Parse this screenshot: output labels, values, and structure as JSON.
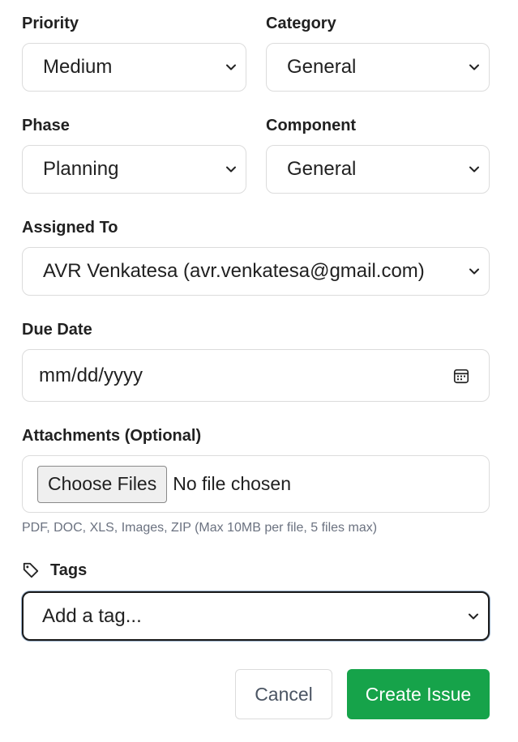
{
  "fields": {
    "priority": {
      "label": "Priority",
      "value": "Medium"
    },
    "category": {
      "label": "Category",
      "value": "General"
    },
    "phase": {
      "label": "Phase",
      "value": "Planning"
    },
    "component": {
      "label": "Component",
      "value": "General"
    },
    "assigned_to": {
      "label": "Assigned To",
      "value": "AVR Venkatesa (avr.venkatesa@gmail.com)"
    },
    "due_date": {
      "label": "Due Date",
      "placeholder": "mm/dd/yyyy"
    },
    "attachments": {
      "label": "Attachments (Optional)",
      "button_label": "Choose Files",
      "status": "No file chosen",
      "hint": "PDF, DOC, XLS, Images, ZIP (Max 10MB per file, 5 files max)"
    },
    "tags": {
      "label": "Tags",
      "placeholder": "Add a tag..."
    }
  },
  "actions": {
    "cancel_label": "Cancel",
    "create_label": "Create Issue"
  },
  "colors": {
    "primary": "#16a34a",
    "border": "#dcdcdc",
    "hint": "#6b7280"
  },
  "icons": {
    "select": "chevron-down-icon",
    "date": "calendar-icon",
    "tags": "tag-icon"
  }
}
